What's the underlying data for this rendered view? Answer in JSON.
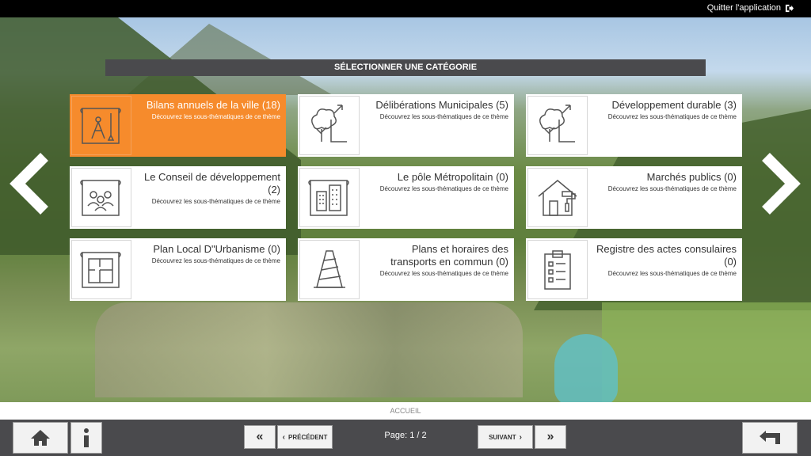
{
  "topbar": {
    "quit_label": "Quitter l'application"
  },
  "header": {
    "title": "SÉLECTIONNER UNE CATÉGORIE"
  },
  "categories": [
    {
      "title": "Bilans annuels de la ville (18)",
      "subtitle": "Découvrez les sous-thématiques de ce thème",
      "icon": "blueprint-tools-icon",
      "active": true
    },
    {
      "title": "Délibérations Municipales (5)",
      "subtitle": "Découvrez les sous-thématiques de ce thème",
      "icon": "tree-plan-icon"
    },
    {
      "title": "Développement durable (3)",
      "subtitle": "Découvrez les sous-thématiques de ce thème",
      "icon": "tree-plan-icon"
    },
    {
      "title": "Le Conseil de développement (2)",
      "subtitle": "Découvrez les sous-thématiques de ce thème",
      "icon": "people-plan-icon"
    },
    {
      "title": "Le pôle Métropolitain (0)",
      "subtitle": "Découvrez les sous-thématiques de ce thème",
      "icon": "buildings-plan-icon"
    },
    {
      "title": "Marchés publics (0)",
      "subtitle": "Découvrez les sous-thématiques de ce thème",
      "icon": "house-paint-icon"
    },
    {
      "title": "Plan Local D\"Urbanisme (0)",
      "subtitle": "Découvrez les sous-thématiques de ce thème",
      "icon": "floor-plan-icon"
    },
    {
      "title": "Plans et horaires des transports en commun (0)",
      "subtitle": "Découvrez les sous-thématiques de ce thème",
      "icon": "traffic-cone-icon"
    },
    {
      "title": "Registre des actes consulaires (0)",
      "subtitle": "Découvrez les sous-thématiques de ce thème",
      "icon": "clipboard-list-icon"
    }
  ],
  "footer": {
    "label": "ACCUEIL"
  },
  "pager": {
    "first_label": "«",
    "prev_label": "PRÉCÉDENT",
    "page_text": "Page: 1 / 2",
    "next_label": "SUIVANT",
    "last_label": "»"
  },
  "colors": {
    "accent": "#f68b2c",
    "bar": "#4a4a4d",
    "card": "#ffffff"
  }
}
